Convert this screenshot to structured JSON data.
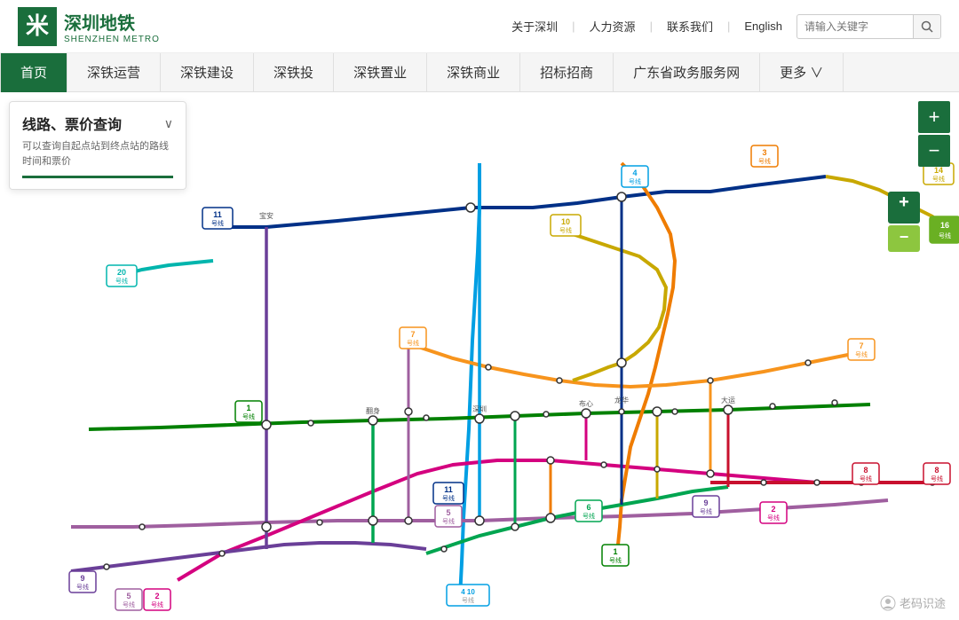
{
  "header": {
    "logo_cn": "深圳地铁",
    "logo_en": "SHENZHEN METRO",
    "nav_links": [
      "关于深圳",
      "人力资源",
      "联系我们",
      "English"
    ],
    "search_placeholder": "请输入关键字"
  },
  "navbar": {
    "items": [
      {
        "label": "首页",
        "active": true
      },
      {
        "label": "深铁运营",
        "active": false
      },
      {
        "label": "深铁建设",
        "active": false
      },
      {
        "label": "深铁投",
        "active": false
      },
      {
        "label": "深铁置业",
        "active": false
      },
      {
        "label": "深铁商业",
        "active": false
      },
      {
        "label": "招标招商",
        "active": false
      },
      {
        "label": "广东省政务服务网",
        "active": false
      },
      {
        "label": "更多 ∨",
        "active": false
      }
    ]
  },
  "info_panel": {
    "title": "线路、票价查询",
    "description": "可以查询自起点站到终点站的路线 时间和票价",
    "chevron": "∨"
  },
  "zoom": {
    "plus": "+",
    "minus": "−"
  },
  "lines": {
    "line1": {
      "color": "#008000",
      "label": "1号线"
    },
    "line2": {
      "color": "#d4007f",
      "label": "2号线"
    },
    "line3": {
      "color": "#ef7c00",
      "label": "3号线"
    },
    "line4": {
      "color": "#009fe3",
      "label": "4号线"
    },
    "line5": {
      "color": "#9f5f9f",
      "label": "5号线"
    },
    "line6": {
      "color": "#00a550",
      "label": "6号线"
    },
    "line7": {
      "color": "#f7941d",
      "label": "7号线"
    },
    "line8": {
      "color": "#c8102e",
      "label": "8号线"
    },
    "line9": {
      "color": "#6a3f98",
      "label": "9号线"
    },
    "line10": {
      "color": "#c8a800",
      "label": "10号线"
    },
    "line11": {
      "color": "#003087",
      "label": "11号线"
    },
    "line14": {
      "color": "#c8a800",
      "label": "14号线"
    },
    "line16": {
      "color": "#6ab023",
      "label": "16号线"
    },
    "line20": {
      "color": "#6ab023",
      "label": "20号线"
    }
  },
  "watermark": "老码识途"
}
